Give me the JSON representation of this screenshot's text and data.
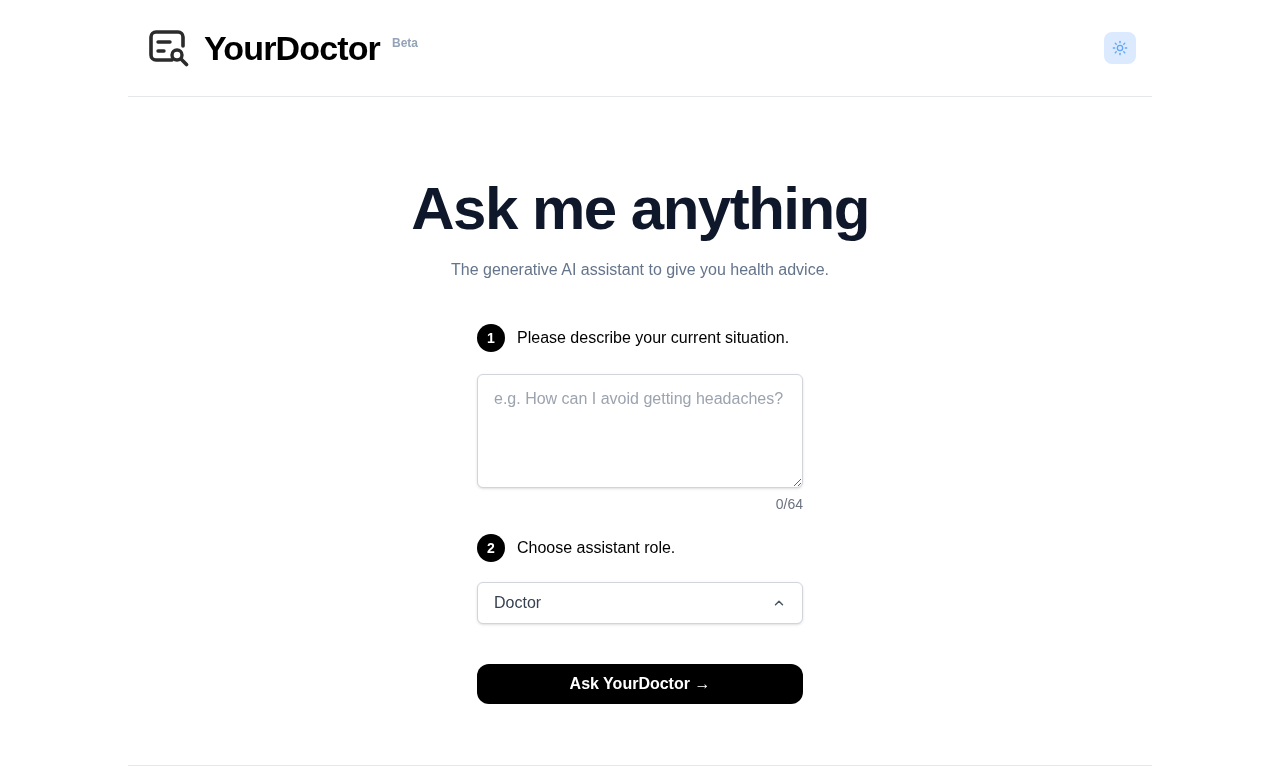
{
  "header": {
    "brand": "YourDoctor",
    "badge": "Beta"
  },
  "hero": {
    "title": "Ask me anything",
    "subtitle": "The generative AI assistant to give you health advice."
  },
  "steps": [
    {
      "number": "1",
      "label": "Please describe your current situation.",
      "kind": "textarea",
      "placeholder": "e.g. How can I avoid getting headaches?",
      "counter": "0/64"
    },
    {
      "number": "2",
      "label": "Choose assistant role.",
      "kind": "select",
      "value": "Doctor"
    }
  ],
  "submit": {
    "label": "Ask YourDoctor →"
  }
}
